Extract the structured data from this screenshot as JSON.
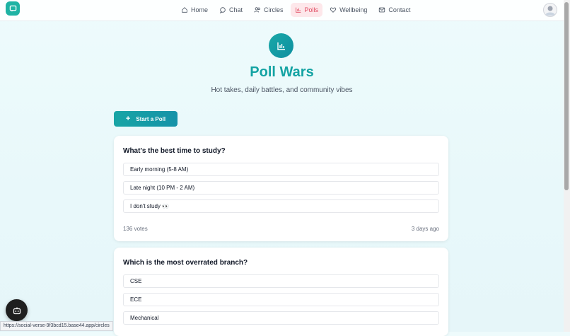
{
  "nav": {
    "items": [
      {
        "label": "Home",
        "icon": "home-icon"
      },
      {
        "label": "Chat",
        "icon": "chat-icon"
      },
      {
        "label": "Circles",
        "icon": "users-icon"
      },
      {
        "label": "Polls",
        "icon": "bar-chart-icon",
        "active": true
      },
      {
        "label": "Wellbeing",
        "icon": "heart-icon"
      },
      {
        "label": "Contact",
        "icon": "mail-icon"
      }
    ]
  },
  "hero": {
    "title": "Poll Wars",
    "subtitle": "Hot takes, daily battles, and community vibes",
    "start_label": "Start a Poll"
  },
  "polls": [
    {
      "question": "What's the best time to study?",
      "options": [
        "Early morning (5-8 AM)",
        "Late night (10 PM - 2 AM)",
        "I don't study 👀"
      ],
      "votes": "136 votes",
      "time": "3 days ago"
    },
    {
      "question": "Which is the most overrated branch?",
      "options": [
        "CSE",
        "ECE",
        "Mechanical"
      ]
    }
  ],
  "status_url": "https://social-verse-9f3bcd15.base44.app/circles",
  "colors": {
    "accent": "#14a3a3",
    "active_nav": "#e0485f",
    "active_nav_bg": "#fde7ea"
  }
}
